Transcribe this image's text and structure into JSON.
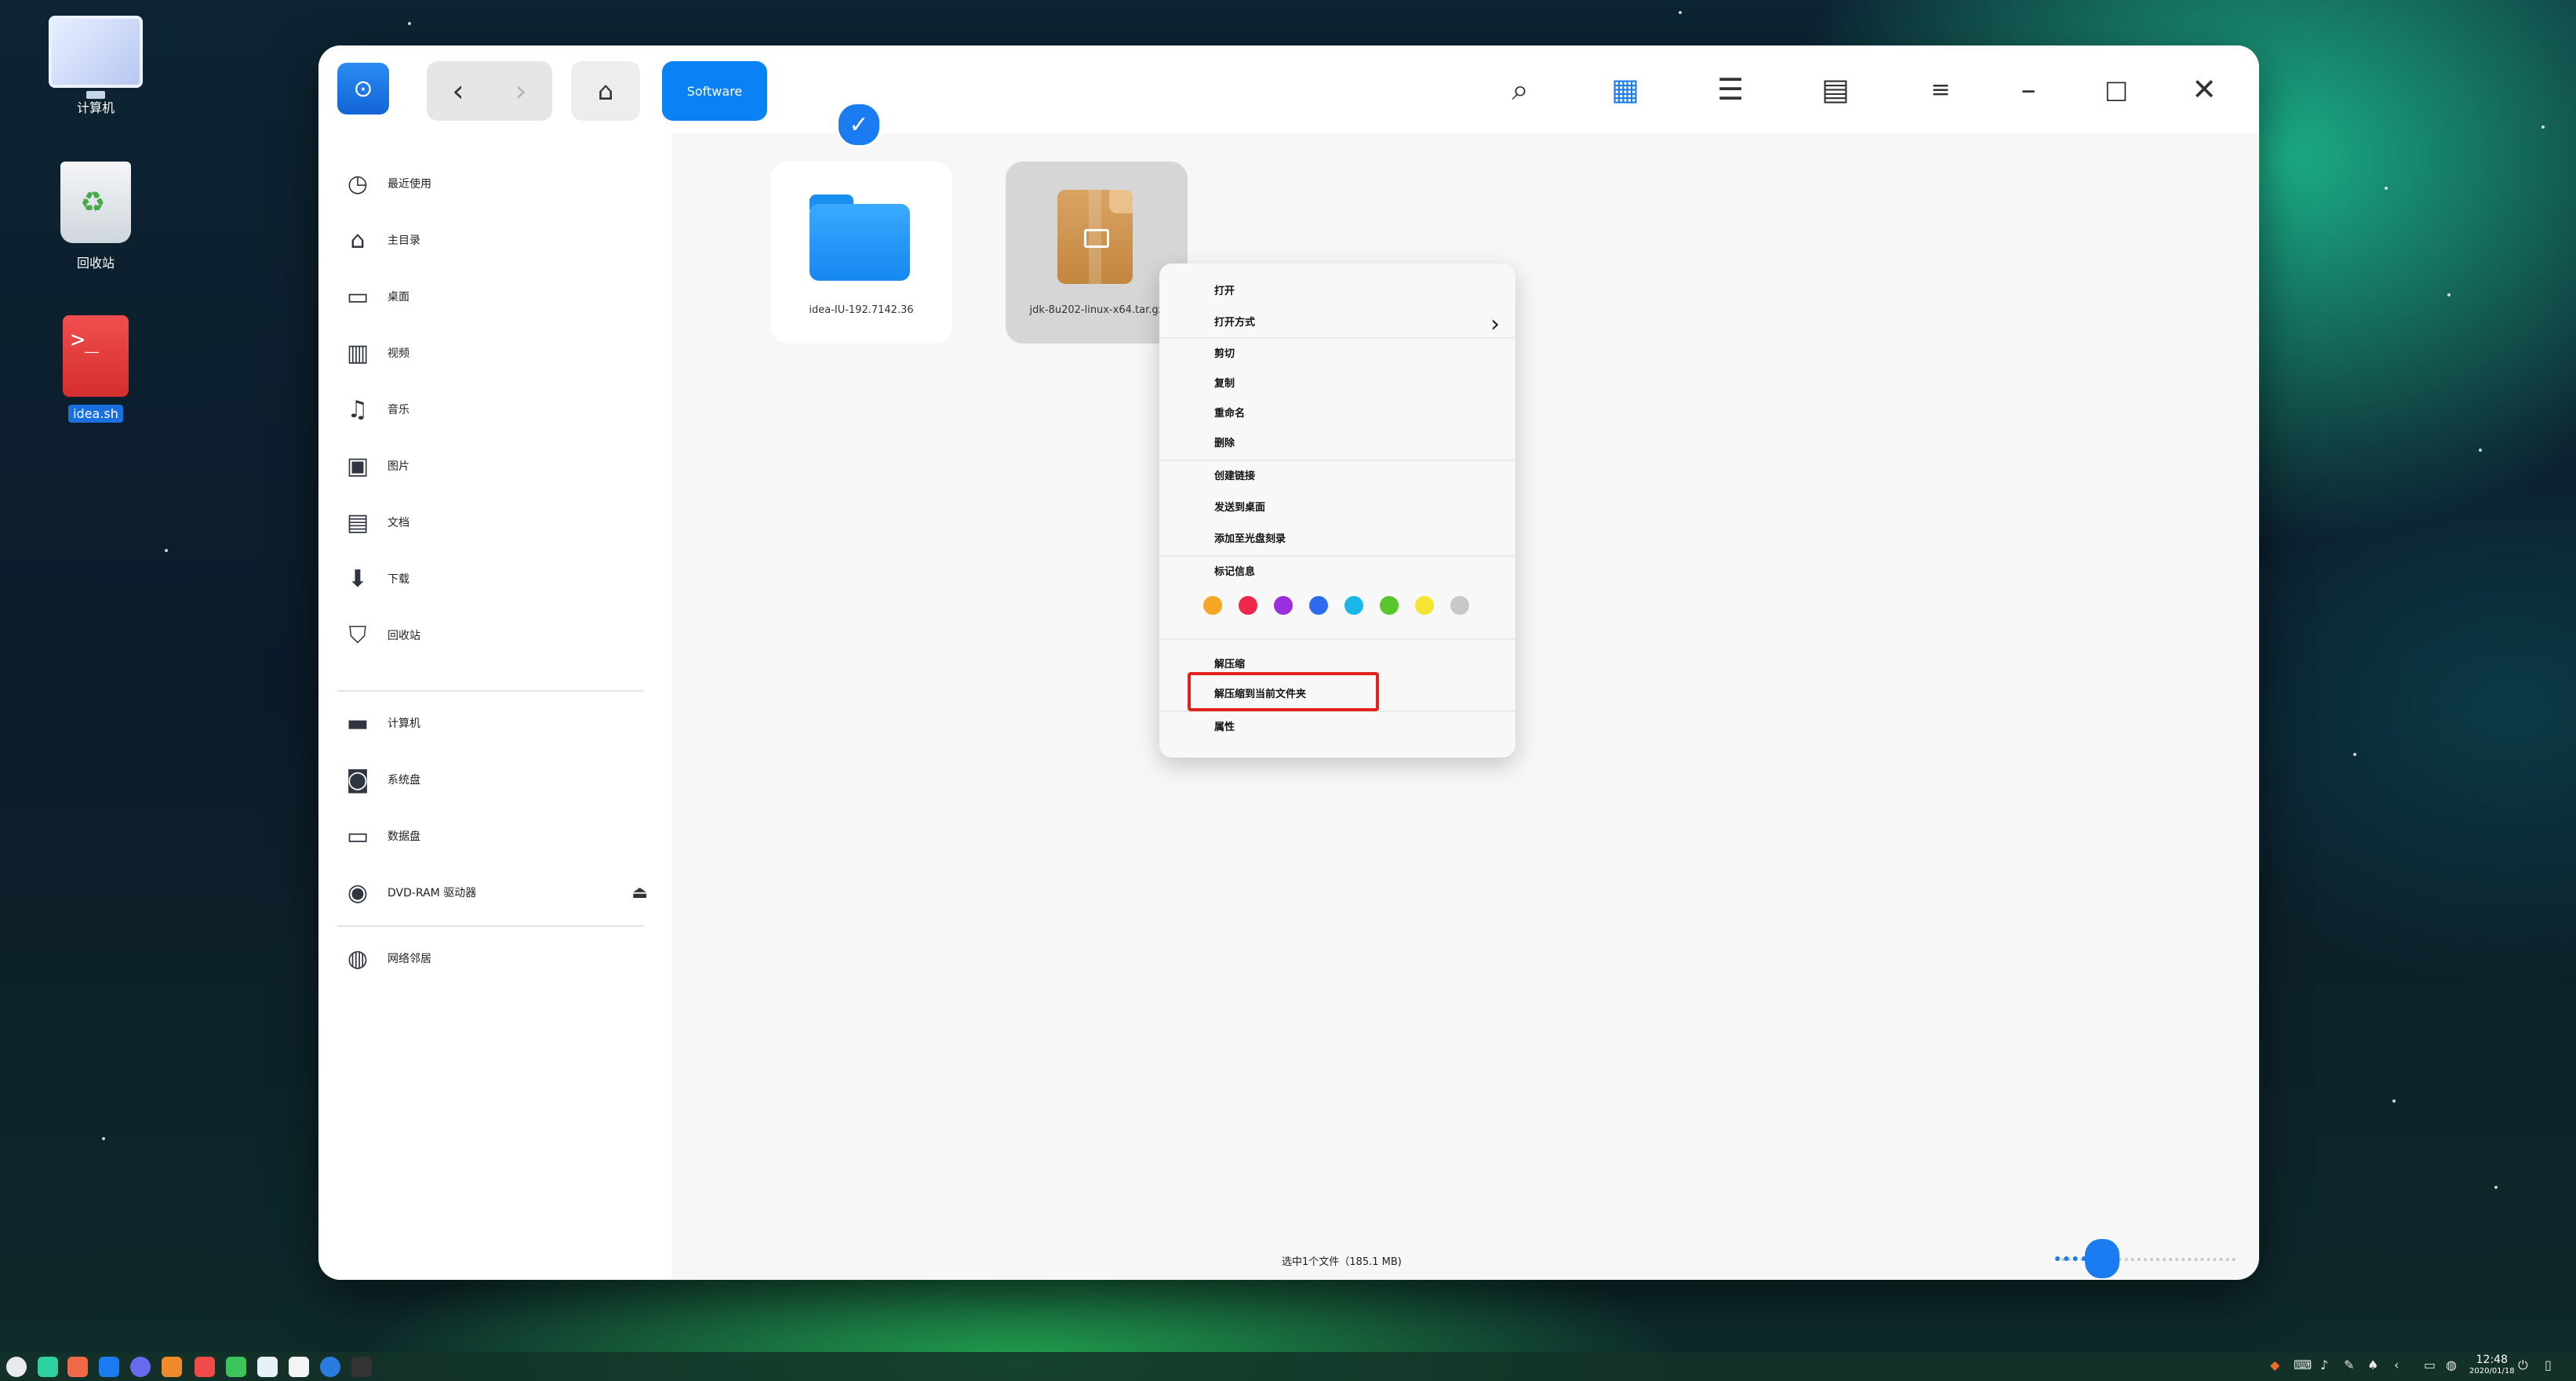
{
  "desktop": {
    "icons": [
      {
        "label": "计算机"
      },
      {
        "label": "回收站"
      },
      {
        "label": "idea.sh"
      }
    ]
  },
  "window": {
    "breadcrumb_current": "Software",
    "icons": {
      "back": "chevron-left-icon",
      "forward": "chevron-right-icon",
      "home": "home-icon",
      "search": "search-icon",
      "grid_view": "grid-view-icon",
      "list_view": "list-view-icon",
      "detail_view": "detail-view-icon",
      "menu": "hamburger-menu-icon",
      "minimize": "minimize-icon",
      "maximize": "maximize-icon",
      "close": "close-icon"
    },
    "accent_color": "#0a82f5"
  },
  "sidebar": {
    "items": [
      {
        "label": "最近使用",
        "icon": "clock-icon"
      },
      {
        "label": "主目录",
        "icon": "home-icon"
      },
      {
        "label": "桌面",
        "icon": "desktop-icon"
      },
      {
        "label": "视频",
        "icon": "video-icon"
      },
      {
        "label": "音乐",
        "icon": "music-icon"
      },
      {
        "label": "图片",
        "icon": "picture-icon"
      },
      {
        "label": "文档",
        "icon": "document-icon"
      },
      {
        "label": "下载",
        "icon": "download-icon"
      },
      {
        "label": "回收站",
        "icon": "trash-icon"
      },
      {
        "label": "计算机",
        "icon": "computer-icon"
      },
      {
        "label": "系统盘",
        "icon": "system-disk-icon"
      },
      {
        "label": "数据盘",
        "icon": "data-disk-icon"
      },
      {
        "label": "DVD-RAM 驱动器",
        "icon": "dvd-icon"
      },
      {
        "label": "网络邻居",
        "icon": "network-icon"
      }
    ]
  },
  "files": [
    {
      "name": "idea-IU-192.7142.36",
      "type": "folder",
      "selected": false
    },
    {
      "name": "jdk-8u202-linux-x64.tar.gz",
      "type": "archive",
      "selected": true
    }
  ],
  "context_menu": {
    "open": "打开",
    "open_with": "打开方式",
    "cut": "剪切",
    "copy": "复制",
    "rename": "重命名",
    "delete": "删除",
    "create_link": "创建链接",
    "send_to_desktop": "发送到桌面",
    "add_to_disc": "添加至光盘刻录",
    "tag_info": "标记信息",
    "tag_colors": [
      "#f5a623",
      "#f0264d",
      "#9b2fe0",
      "#2d6cf0",
      "#1ab8e8",
      "#5ac62e",
      "#f5e532",
      "#c8c8c8"
    ],
    "extract": "解压缩",
    "extract_here": "解压缩到当前文件夹",
    "properties": "属性"
  },
  "status": {
    "selection_text": "选中1个文件（185.1 MB)"
  },
  "taskbar": {
    "time": "12:48",
    "date": "2020/01/18"
  }
}
